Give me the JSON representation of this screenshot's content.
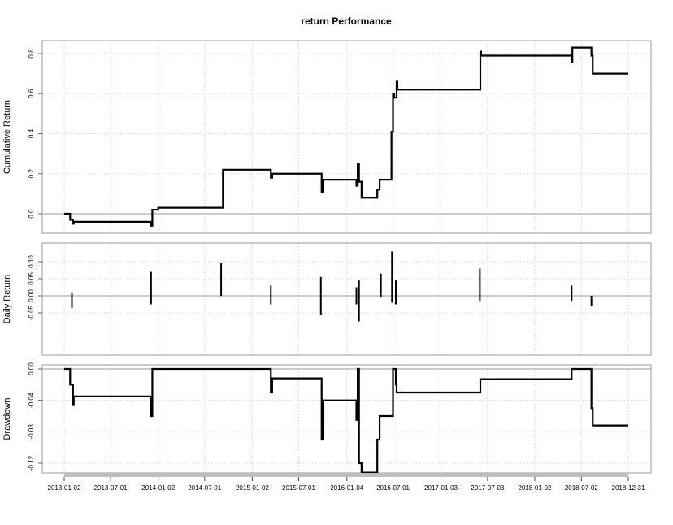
{
  "chart_data": {
    "type": "line",
    "title": "return Performance",
    "x_tick_labels": [
      "2013-01-02",
      "2013-07-01",
      "2014-01-02",
      "2014-07-01",
      "2015-01-02",
      "2015-07-01",
      "2016-01-04",
      "2016-07-01",
      "2017-01-03",
      "2017-07-03",
      "2018-01-02",
      "2018-07-02",
      "2018-12-31"
    ],
    "x_range": [
      "2013-01-02",
      "2018-12-31"
    ],
    "grid": true,
    "panels": [
      {
        "id": "cumulative",
        "ylabel": "Cumulative Return",
        "ylim": [
          -0.1,
          0.9
        ],
        "y_ticks": [
          0.0,
          0.2,
          0.4,
          0.6,
          0.8
        ],
        "y_tick_labels": [
          "0.0",
          "0.2",
          "0.4",
          "0.6",
          "0.8"
        ],
        "baseline": 0,
        "series": [
          {
            "type": "step",
            "x": [
              "2013-01-02",
              "2013-01-25",
              "2013-02-05",
              "2013-02-08",
              "2013-11-30",
              "2013-12-05",
              "2013-12-10",
              "2014-01-02",
              "2014-09-01",
              "2014-09-10",
              "2015-03-10",
              "2015-03-15",
              "2015-03-20",
              "2015-09-20",
              "2015-09-28",
              "2015-10-05",
              "2016-02-05",
              "2016-02-10",
              "2016-02-15",
              "2016-02-20",
              "2016-03-01",
              "2016-04-15",
              "2016-05-01",
              "2016-05-10",
              "2016-06-15",
              "2016-06-25",
              "2016-07-01",
              "2016-07-05",
              "2016-07-12",
              "2016-07-15",
              "2016-07-18",
              "2017-06-01",
              "2017-06-05",
              "2017-06-08",
              "2018-05-20",
              "2018-05-25",
              "2018-05-28",
              "2018-08-01",
              "2018-08-10",
              "2018-08-15",
              "2018-12-31"
            ],
            "y": [
              0.0,
              -0.03,
              -0.05,
              -0.04,
              -0.04,
              -0.06,
              0.02,
              0.03,
              0.03,
              0.22,
              0.22,
              0.18,
              0.2,
              0.2,
              0.11,
              0.17,
              0.17,
              0.14,
              0.25,
              0.16,
              0.08,
              0.08,
              0.12,
              0.17,
              0.17,
              0.41,
              0.6,
              0.58,
              0.58,
              0.66,
              0.62,
              0.62,
              0.81,
              0.79,
              0.79,
              0.76,
              0.83,
              0.83,
              0.79,
              0.7,
              0.7
            ]
          }
        ]
      },
      {
        "id": "daily",
        "ylabel": "Daily Return",
        "ylim": [
          -0.08,
          0.14
        ],
        "y_ticks": [
          -0.05,
          0.0,
          0.05,
          0.1
        ],
        "y_tick_labels": [
          "-0.05",
          "0.00",
          "0.05",
          "0.10"
        ],
        "baseline": 0,
        "spikes": [
          {
            "x": "2013-02-01",
            "low": -0.035,
            "high": 0.01
          },
          {
            "x": "2013-12-05",
            "low": -0.025,
            "high": 0.07
          },
          {
            "x": "2014-09-03",
            "low": 0.0,
            "high": 0.095
          },
          {
            "x": "2015-03-15",
            "low": -0.025,
            "high": 0.03
          },
          {
            "x": "2015-09-25",
            "low": -0.055,
            "high": 0.055
          },
          {
            "x": "2016-02-10",
            "low": -0.025,
            "high": 0.025
          },
          {
            "x": "2016-02-20",
            "low": -0.075,
            "high": 0.045
          },
          {
            "x": "2016-05-15",
            "low": -0.005,
            "high": 0.065
          },
          {
            "x": "2016-06-27",
            "low": -0.02,
            "high": 0.13
          },
          {
            "x": "2016-07-12",
            "low": -0.025,
            "high": 0.045
          },
          {
            "x": "2017-06-03",
            "low": -0.015,
            "high": 0.08
          },
          {
            "x": "2018-05-25",
            "low": -0.015,
            "high": 0.03
          },
          {
            "x": "2018-08-10",
            "low": -0.03,
            "high": 0.0
          }
        ]
      },
      {
        "id": "drawdown",
        "ylabel": "Drawdown",
        "ylim": [
          -0.14,
          0.005
        ],
        "y_ticks": [
          0.0,
          -0.04,
          -0.08,
          -0.12
        ],
        "y_tick_labels": [
          "0.00",
          "-0.04",
          "-0.08",
          "-0.12"
        ],
        "baseline": 0,
        "series": [
          {
            "type": "step",
            "x": [
              "2013-01-02",
              "2013-01-25",
              "2013-02-05",
              "2013-02-08",
              "2013-11-30",
              "2013-12-05",
              "2013-12-10",
              "2015-03-10",
              "2015-03-15",
              "2015-03-20",
              "2015-09-20",
              "2015-09-28",
              "2015-10-05",
              "2016-02-05",
              "2016-02-10",
              "2016-02-15",
              "2016-02-20",
              "2016-03-01",
              "2016-04-15",
              "2016-05-01",
              "2016-05-10",
              "2016-06-25",
              "2016-07-01",
              "2016-07-12",
              "2016-07-15",
              "2017-06-01",
              "2017-06-05",
              "2018-05-20",
              "2018-05-25",
              "2018-08-01",
              "2018-08-10",
              "2018-08-15",
              "2018-12-31"
            ],
            "y": [
              0.0,
              -0.02,
              -0.045,
              -0.035,
              -0.035,
              -0.06,
              0.0,
              0.0,
              -0.03,
              -0.012,
              -0.012,
              -0.09,
              -0.04,
              -0.04,
              -0.065,
              0.0,
              -0.12,
              -0.132,
              -0.132,
              -0.09,
              -0.06,
              -0.06,
              0.0,
              -0.02,
              -0.03,
              -0.03,
              -0.013,
              -0.013,
              0.0,
              0.0,
              -0.05,
              -0.072,
              -0.072
            ]
          }
        ]
      }
    ]
  }
}
